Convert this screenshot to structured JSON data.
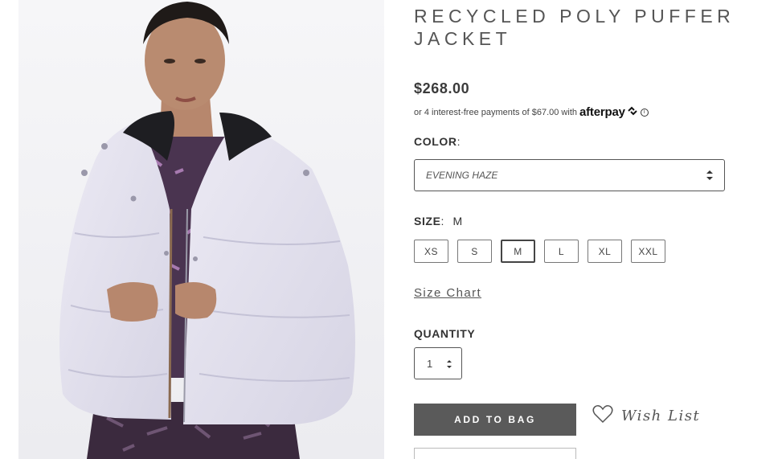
{
  "product": {
    "title": "RECYCLED POLY PUFFER JACKET",
    "price": "$268.00",
    "image_alt": "Model wearing lavender puffer jacket"
  },
  "afterpay": {
    "text": "or 4 interest-free payments of $67.00 with",
    "logo": "afterpay",
    "info_icon": "i"
  },
  "color": {
    "label": "COLOR",
    "colon": ":",
    "selected": "EVENING HAZE"
  },
  "size": {
    "label": "SIZE",
    "colon": ":",
    "selected": "M",
    "options": [
      "XS",
      "S",
      "M",
      "L",
      "XL",
      "XXL"
    ]
  },
  "size_chart": "Size Chart",
  "quantity": {
    "label": "QUANTITY",
    "value": "1"
  },
  "actions": {
    "add_to_bag": "ADD TO BAG",
    "wish_list": "Wish List"
  },
  "colors": {
    "primary_button": "#5a5a5a",
    "jacket": "#e4e3ef"
  }
}
